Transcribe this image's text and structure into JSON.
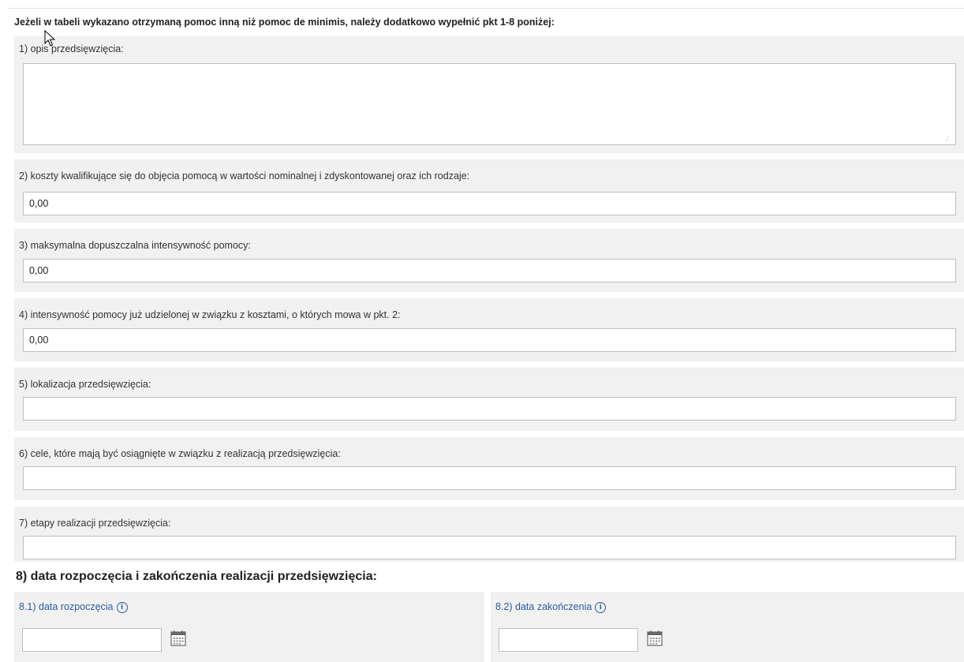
{
  "header": {
    "instruction": "Jeżeli w tabeli wykazano otrzymaną pomoc inną niż pomoc de minimis, należy dodatkowo wypełnić pkt 1-8 poniżej:"
  },
  "fields": [
    {
      "label": "1) opis przedsięwzięcia:",
      "value": ""
    },
    {
      "label": "2) koszty kwalifikujące się do objęcia pomocą w wartości nominalnej i zdyskontowanej oraz ich rodzaje:",
      "value": "0,00"
    },
    {
      "label": "3) maksymalna dopuszczalna intensywność pomocy:",
      "value": "0,00"
    },
    {
      "label": "4) intensywność pomocy już udzielonej w związku z kosztami, o których mowa w pkt. 2:",
      "value": "0,00"
    },
    {
      "label": "5) lokalizacja przedsięwzięcia:",
      "value": ""
    },
    {
      "label": "6) cele, które mają być osiągnięte w związku z realizacją przedsięwzięcia:",
      "value": ""
    },
    {
      "label": "7) etapy realizacji przedsięwzięcia:",
      "value": ""
    }
  ],
  "section8": {
    "title": "8) data rozpoczęcia i zakończenia realizacji przedsięwzięcia:",
    "start": {
      "label": "8.1) data rozpoczęcia",
      "value": ""
    },
    "end": {
      "label": "8.2) data zakończenia",
      "value": ""
    }
  },
  "icons": {
    "info": "info-icon",
    "calendar": "calendar-icon",
    "cursor": "mouse-cursor-icon"
  },
  "colors": {
    "section_bg": "#f1f1f1",
    "link_blue": "#2a5c9e",
    "border": "#bfbfbf"
  }
}
